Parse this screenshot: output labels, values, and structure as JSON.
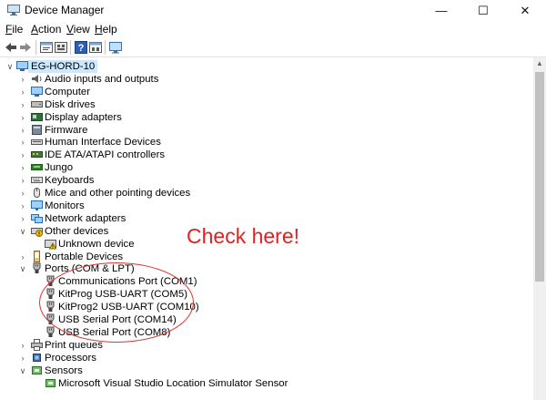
{
  "window": {
    "title": "Device Manager",
    "minimize": "—",
    "maximize": "☐",
    "close": "✕"
  },
  "menu": [
    {
      "label": "File",
      "u": "F",
      "rest": "ile"
    },
    {
      "label": "Action",
      "u": "A",
      "rest": "ction"
    },
    {
      "label": "View",
      "u": "V",
      "rest": "iew"
    },
    {
      "label": "Help",
      "u": "H",
      "rest": "elp"
    }
  ],
  "toolbar": {
    "icons": [
      "back-arrow-icon",
      "forward-arrow-icon",
      "properties-icon",
      "show-hidden-icon",
      "help-icon",
      "update-driver-icon",
      "monitor-icon"
    ]
  },
  "tree": {
    "root": "EG-HORD-10",
    "categories": [
      {
        "label": "Audio inputs and outputs",
        "icon": "speaker-icon",
        "expanded": false
      },
      {
        "label": "Computer",
        "icon": "computer-icon",
        "expanded": false
      },
      {
        "label": "Disk drives",
        "icon": "disk-drive-icon",
        "expanded": false
      },
      {
        "label": "Display adapters",
        "icon": "display-adapter-icon",
        "expanded": false
      },
      {
        "label": "Firmware",
        "icon": "firmware-icon",
        "expanded": false
      },
      {
        "label": "Human Interface Devices",
        "icon": "hid-icon",
        "expanded": false
      },
      {
        "label": "IDE ATA/ATAPI controllers",
        "icon": "ide-controller-icon",
        "expanded": false
      },
      {
        "label": "Jungo",
        "icon": "jungo-icon",
        "expanded": false
      },
      {
        "label": "Keyboards",
        "icon": "keyboard-icon",
        "expanded": false
      },
      {
        "label": "Mice and other pointing devices",
        "icon": "mouse-icon",
        "expanded": false
      },
      {
        "label": "Monitors",
        "icon": "monitor-icon",
        "expanded": false
      },
      {
        "label": "Network adapters",
        "icon": "network-adapter-icon",
        "expanded": false
      },
      {
        "label": "Other devices",
        "icon": "other-devices-icon",
        "expanded": true,
        "children": [
          {
            "label": "Unknown device",
            "icon": "unknown-device-icon"
          }
        ]
      },
      {
        "label": "Portable Devices",
        "icon": "portable-device-icon",
        "expanded": false
      },
      {
        "label": "Ports (COM & LPT)",
        "icon": "port-icon",
        "expanded": true,
        "children": [
          {
            "label": "Communications Port (COM1)",
            "icon": "port-icon"
          },
          {
            "label": "KitProg USB-UART (COM5)",
            "icon": "port-icon"
          },
          {
            "label": "KitProg2 USB-UART (COM10)",
            "icon": "port-icon"
          },
          {
            "label": "USB Serial Port (COM14)",
            "icon": "port-icon"
          },
          {
            "label": "USB Serial Port (COM8)",
            "icon": "port-icon"
          }
        ]
      },
      {
        "label": "Print queues",
        "icon": "printer-icon",
        "expanded": false
      },
      {
        "label": "Processors",
        "icon": "processor-icon",
        "expanded": false
      },
      {
        "label": "Sensors",
        "icon": "sensor-icon",
        "expanded": true,
        "children": [
          {
            "label": "Microsoft Visual Studio Location Simulator Sensor",
            "icon": "sensor-icon"
          }
        ]
      }
    ]
  },
  "annotation": {
    "text": "Check here!",
    "color": "#e32020"
  }
}
